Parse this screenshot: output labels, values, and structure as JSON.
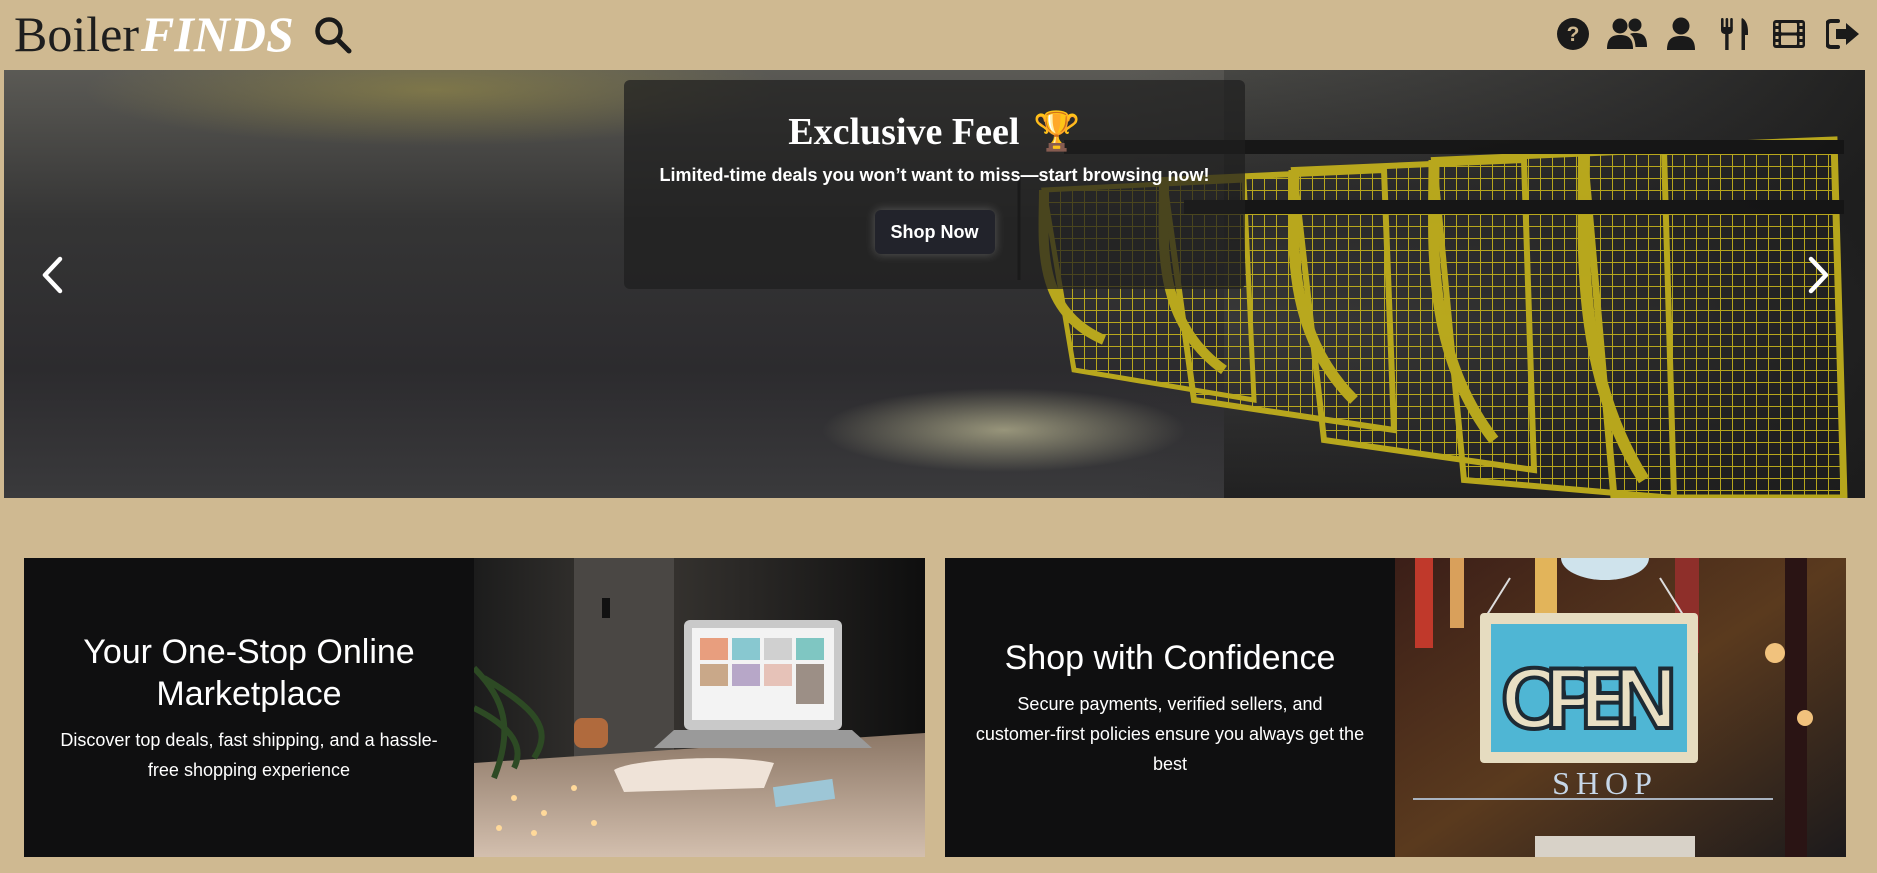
{
  "header": {
    "logo_part1": "Boiler",
    "logo_part2": "FINDS",
    "search_label": "search",
    "icons": [
      "help-icon",
      "users-icon",
      "user-icon",
      "utensils-icon",
      "film-icon",
      "sign-out-icon"
    ]
  },
  "hero": {
    "title": "Exclusive Feel",
    "title_emoji": "🏆",
    "subtitle": "Limited-time deals you won’t want to miss—start browsing now!",
    "button_label": "Shop Now"
  },
  "cards": [
    {
      "title": "Your One-Stop Online Marketplace",
      "body": "Discover top deals, fast shipping, and a hassle-free shopping experience",
      "image_subject": "laptop on a table with string lights"
    },
    {
      "title": "Shop with Confidence",
      "body": "Secure payments, verified sellers, and customer-first policies ensure you always get the best",
      "image_subject": "open shop sign on a door"
    }
  ],
  "sign": {
    "open_text": "OPEN",
    "shop_text": "SHOP"
  },
  "colors": {
    "background": "#cfb991",
    "dark_card": "#0f0f10",
    "caption_bg": "rgba(30,30,30,0.72)",
    "cart_yellow": "#c4b21c"
  }
}
